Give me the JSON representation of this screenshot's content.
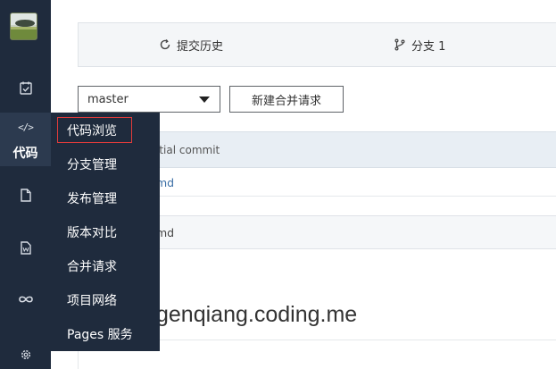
{
  "sidebar": {
    "code_label": "代码",
    "code_glyph": "</>",
    "icons": [
      "avatar",
      "task-icon",
      "code-icon",
      "file-icon",
      "wiki-icon",
      "infinity-icon",
      "gear-icon"
    ]
  },
  "topbar": {
    "history_tab": "提交历史",
    "branches_tab": "分支 1"
  },
  "branch_select": {
    "value": "master"
  },
  "new_merge_request_button": "新建合并请求",
  "commit": {
    "message": "itial commit"
  },
  "files": [
    {
      "name": "md"
    }
  ],
  "readme": {
    "header": "md",
    "title": "genqiang.coding.me"
  },
  "menu": {
    "items": [
      {
        "label": "代码浏览",
        "active": true
      },
      {
        "label": "分支管理"
      },
      {
        "label": "发布管理"
      },
      {
        "label": "版本对比"
      },
      {
        "label": "合并请求"
      },
      {
        "label": "项目网络"
      },
      {
        "label": "Pages 服务"
      }
    ]
  },
  "colors": {
    "sidebar_bg": "#1f2b3d",
    "active_bg": "#2c3a4f",
    "highlight_border": "#e03b3b",
    "link": "#3a6ea5"
  }
}
